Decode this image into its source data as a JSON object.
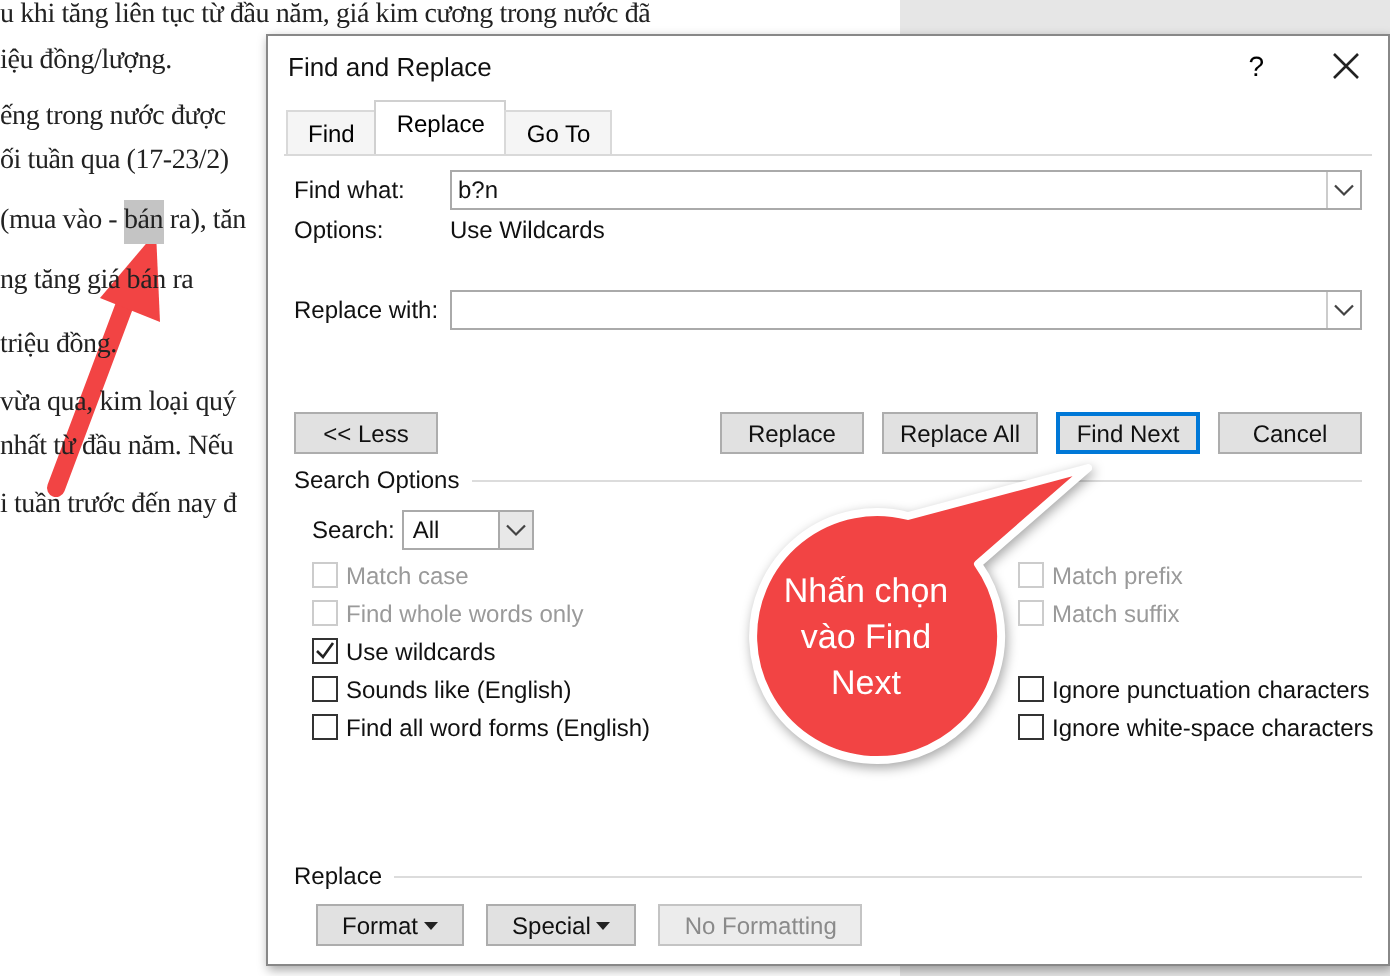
{
  "document": {
    "lines": [
      {
        "segments": [
          {
            "text": "u khi tăng liên tục từ đầu năm, giá kim cương trong nước đã",
            "selected": false
          }
        ]
      },
      {
        "segments": [
          {
            "text": "iệu đồng/lượng.",
            "selected": false
          }
        ]
      },
      {
        "segments": [
          {
            "text": "ếng trong nước được",
            "selected": false
          }
        ]
      },
      {
        "segments": [
          {
            "text": "ối tuần qua (17-23/2)",
            "selected": false
          }
        ]
      },
      {
        "segments": [
          {
            "text": "(mua vào - ",
            "selected": false
          },
          {
            "text": "bán",
            "selected": true
          },
          {
            "text": " ra), tăn",
            "selected": false
          }
        ]
      },
      {
        "segments": [
          {
            "text": "ng tăng giá bán ra",
            "selected": false
          }
        ]
      },
      {
        "segments": [
          {
            "text": "triệu đồng.",
            "selected": false
          }
        ]
      },
      {
        "segments": [
          {
            "text": "vừa qua, kim loại quý",
            "selected": false
          }
        ]
      },
      {
        "segments": [
          {
            "text": "nhất từ đầu năm. Nếu",
            "selected": false
          }
        ]
      },
      {
        "segments": [
          {
            "text": "i tuần trước đến nay đ",
            "selected": false
          }
        ]
      }
    ]
  },
  "dialog": {
    "title": "Find and Replace",
    "help": "?",
    "tabs": [
      {
        "label": "Find",
        "selected": false
      },
      {
        "label": "Replace",
        "selected": true
      },
      {
        "label": "Go To",
        "selected": false
      }
    ],
    "find_what": {
      "label": "Find what:",
      "value": "b?n"
    },
    "options": {
      "label": "Options:",
      "value": "Use Wildcards"
    },
    "replace_with": {
      "label": "Replace with:"
    },
    "buttons": [
      {
        "label": "<< Less",
        "focused": false
      },
      {
        "label": "Replace",
        "focused": false
      },
      {
        "label": "Replace All",
        "focused": false
      },
      {
        "label": "Find Next",
        "focused": true
      },
      {
        "label": "Cancel",
        "focused": false
      }
    ],
    "search_options": {
      "title": "Search Options",
      "search_label": "Search:",
      "search_value": "All",
      "left": [
        {
          "label": "Match case",
          "checked": false,
          "disabled": true
        },
        {
          "label": "Find whole words only",
          "checked": false,
          "disabled": true
        },
        {
          "label": "Use wildcards",
          "checked": true,
          "disabled": false
        },
        {
          "label": "Sounds like (English)",
          "checked": false,
          "disabled": false
        },
        {
          "label": "Find all word forms (English)",
          "checked": false,
          "disabled": false
        }
      ],
      "right": [
        {
          "label": "Match prefix",
          "checked": false,
          "disabled": true
        },
        {
          "label": "Match suffix",
          "checked": false,
          "disabled": true
        },
        {
          "label": "Ignore punctuation characters",
          "checked": false,
          "disabled": false
        },
        {
          "label": "Ignore white-space characters",
          "checked": false,
          "disabled": false
        }
      ]
    },
    "replace_section": {
      "title": "Replace",
      "buttons": [
        {
          "label": "Format",
          "dropdown": true,
          "disabled": false
        },
        {
          "label": "Special",
          "dropdown": true,
          "disabled": false
        },
        {
          "label": "No Formatting",
          "dropdown": false,
          "disabled": true
        }
      ]
    }
  },
  "callout": {
    "text": "Nhấn chọn vào Find Next"
  }
}
